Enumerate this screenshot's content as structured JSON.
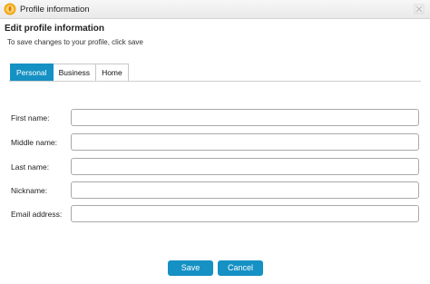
{
  "window": {
    "title": "Profile information",
    "app_icon": "profile-app-icon",
    "close_icon": "close-icon"
  },
  "heading": "Edit profile information",
  "subheading": "To save changes to your profile, click save",
  "tabs": [
    {
      "label": "Personal",
      "active": true
    },
    {
      "label": "Business",
      "active": false
    },
    {
      "label": "Home",
      "active": false
    }
  ],
  "fields": [
    {
      "label": "First name:",
      "value": "",
      "placeholder": ""
    },
    {
      "label": "Middle name:",
      "value": "",
      "placeholder": ""
    },
    {
      "label": "Last name:",
      "value": "",
      "placeholder": ""
    },
    {
      "label": "Nickname:",
      "value": "",
      "placeholder": ""
    },
    {
      "label": "Email address:",
      "value": "",
      "placeholder": ""
    }
  ],
  "buttons": {
    "save": "Save",
    "cancel": "Cancel"
  },
  "colors": {
    "accent": "#1591c4"
  }
}
